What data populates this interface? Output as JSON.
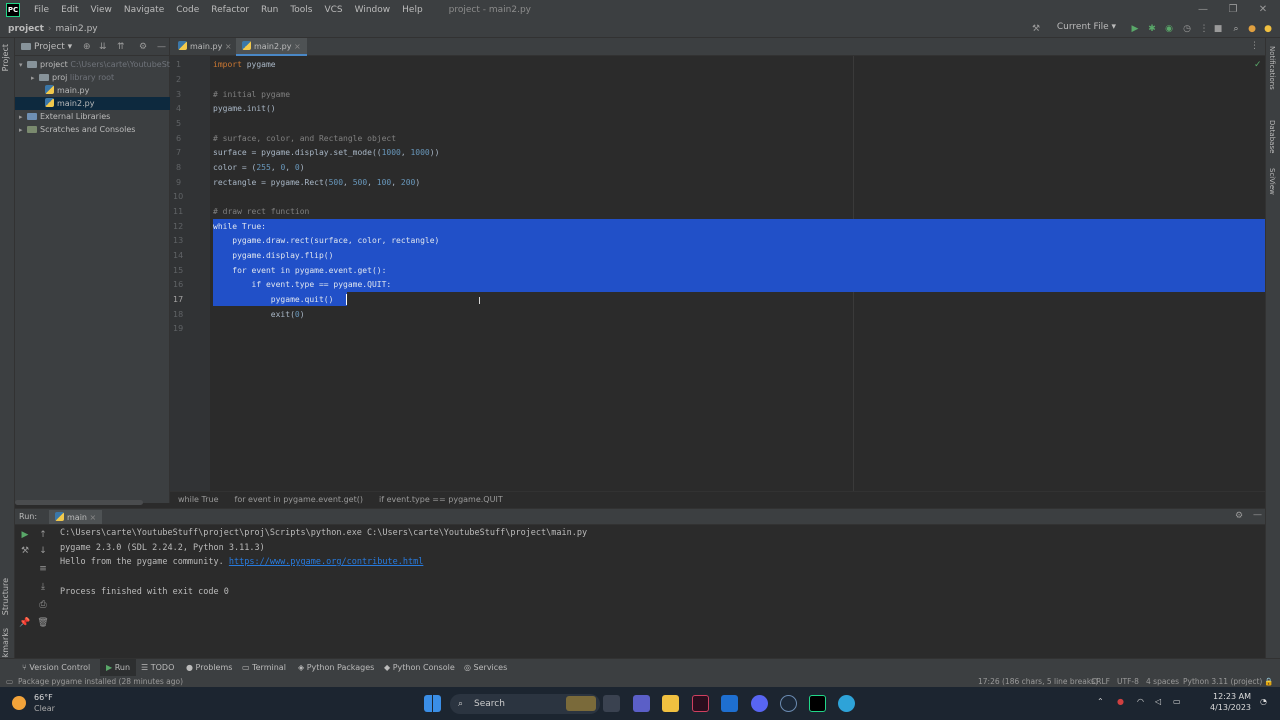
{
  "window": {
    "logo": "PC",
    "title": "project - main2.py",
    "menu": [
      "File",
      "Edit",
      "View",
      "Navigate",
      "Code",
      "Refactor",
      "Run",
      "Tools",
      "VCS",
      "Window",
      "Help"
    ],
    "controls": {
      "minimize": "—",
      "maximize": "❐",
      "close": "✕"
    }
  },
  "navbar": {
    "crumbs": [
      "project",
      "main2.py"
    ],
    "run_config": "Current File ▾"
  },
  "left_strip": {
    "project": "Project",
    "structure": "Structure",
    "bookmarks": "Bookmarks"
  },
  "right_strip": {
    "notifications": "Notifications",
    "database": "Database",
    "sciview": "SciView"
  },
  "project_panel": {
    "header": "Project ▾",
    "tree": [
      {
        "label": "project",
        "hint": "C:\\Users\\carte\\YoutubeStuff",
        "type": "folder"
      },
      {
        "label": "proj",
        "hint": "library root",
        "type": "folder"
      },
      {
        "label": "main.py",
        "hint": "",
        "type": "py"
      },
      {
        "label": "main2.py",
        "hint": "",
        "type": "py"
      },
      {
        "label": "External Libraries",
        "hint": "",
        "type": "lib"
      },
      {
        "label": "Scratches and Consoles",
        "hint": "",
        "type": "scratch"
      }
    ]
  },
  "editor": {
    "tabs": [
      "main.py",
      "main2.py"
    ],
    "active_tab": "main2.py",
    "lines": [
      "1",
      "2",
      "3",
      "4",
      "5",
      "6",
      "7",
      "8",
      "9",
      "10",
      "11",
      "12",
      "13",
      "14",
      "15",
      "16",
      "17",
      "18",
      "19"
    ],
    "code": {
      "l1_kw": "import",
      "l1_rest": " pygame",
      "l3": "# initial pygame",
      "l4": "pygame.init()",
      "l6": "# surface, color, and Rectangle object",
      "l7_a": "surface = pygame.display.set_mode((",
      "l7_n1": "1000",
      "l7_sep": ", ",
      "l7_n2": "1000",
      "l7_b": "))",
      "l8_a": "color = (",
      "l8_n1": "255",
      "l8_sep1": ", ",
      "l8_n2": "0",
      "l8_sep2": ", ",
      "l8_n3": "0",
      "l8_b": ")",
      "l9_a": "rectangle = pygame.Rect(",
      "l9_n1": "500",
      "l9_n2": "500",
      "l9_n3": "100",
      "l9_n4": "200",
      "l9_sep": ", ",
      "l9_b": ")",
      "l11": "# draw rect function",
      "l12": "while True:",
      "l13": "    pygame.draw.rect(surface, color, rectangle)",
      "l14": "    pygame.display.flip()",
      "l15": "    for event in pygame.event.get():",
      "l16": "        if event.type == pygame.QUIT:",
      "l17": "            pygame.quit()",
      "l18_a": "            exit(",
      "l18_n": "0",
      "l18_b": ")"
    },
    "breadcrumbs": [
      "while True",
      "for event in pygame.event.get()",
      "if event.type == pygame.QUIT"
    ]
  },
  "run_panel": {
    "label": "Run:",
    "tab": "main",
    "console": {
      "cmd": "C:\\Users\\carte\\YoutubeStuff\\project\\proj\\Scripts\\python.exe C:\\Users\\carte\\YoutubeStuff\\project\\main.py",
      "version": "pygame 2.3.0 (SDL 2.24.2, Python 3.11.3)",
      "hello": "Hello from the pygame community. ",
      "link": "https://www.pygame.org/contribute.html",
      "exit": "Process finished with exit code 0"
    }
  },
  "tool_tabs": [
    "Version Control",
    "Run",
    "TODO",
    "Problems",
    "Terminal",
    "Python Packages",
    "Python Console",
    "Services"
  ],
  "status": {
    "message": "Package pygame installed (28 minutes ago)",
    "position": "17:26 (186 chars, 5 line breaks)",
    "line_sep": "CRLF",
    "encoding": "UTF-8",
    "indent": "4 spaces",
    "interpreter": "Python 3.11 (project)"
  },
  "taskbar": {
    "weather_temp": "66°F",
    "weather_desc": "Clear",
    "search": "Search",
    "time": "12:23 AM",
    "date": "4/13/2023"
  }
}
